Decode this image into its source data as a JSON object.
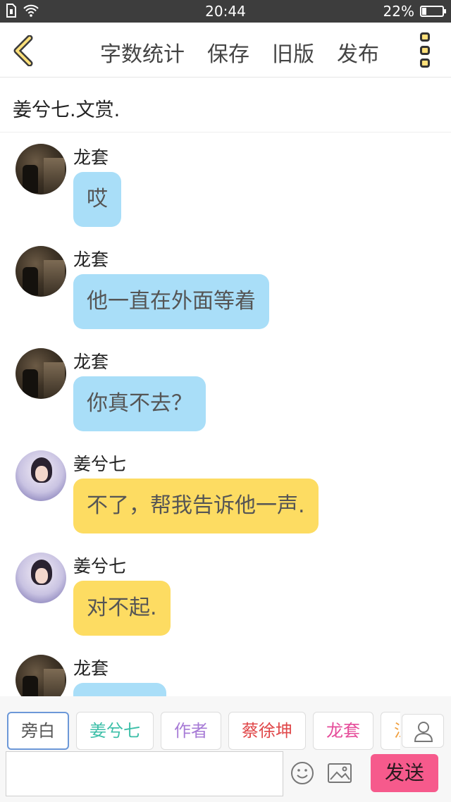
{
  "status_bar": {
    "time": "20:44",
    "battery_text": "22%",
    "battery_level": 0.22
  },
  "toolbar": {
    "actions": [
      {
        "label": "字数统计"
      },
      {
        "label": "保存"
      },
      {
        "label": "旧版"
      },
      {
        "label": "发布"
      }
    ]
  },
  "story": {
    "title": "姜兮七.文赏."
  },
  "messages": [
    {
      "sender": "龙套",
      "text": "哎",
      "style": "blue"
    },
    {
      "sender": "龙套",
      "text": "他一直在外面等着",
      "style": "blue"
    },
    {
      "sender": "龙套",
      "text": "你真不去？",
      "style": "blue"
    },
    {
      "sender": "姜兮七",
      "text": "不了，帮我告诉他一声.",
      "style": "yellow"
    },
    {
      "sender": "姜兮七",
      "text": "对不起.",
      "style": "yellow"
    },
    {
      "sender": "龙套",
      "text": "",
      "style": "blue"
    }
  ],
  "roles": [
    {
      "label": "旁白",
      "color": "#555555",
      "selected": true
    },
    {
      "label": "姜兮七",
      "color": "#3cbfa8",
      "selected": false
    },
    {
      "label": "作者",
      "color": "#a77bd6",
      "selected": false
    },
    {
      "label": "蔡徐坤",
      "color": "#e0484a",
      "selected": false
    },
    {
      "label": "龙套",
      "color": "#e64c9a",
      "selected": false
    },
    {
      "label": "江",
      "color": "#f0a040",
      "selected": false
    }
  ],
  "composer": {
    "input_value": "",
    "send_label": "发送"
  },
  "colors": {
    "bubble_blue": "#a9def8",
    "bubble_yellow": "#fddc62",
    "send_button": "#f65a8c"
  }
}
